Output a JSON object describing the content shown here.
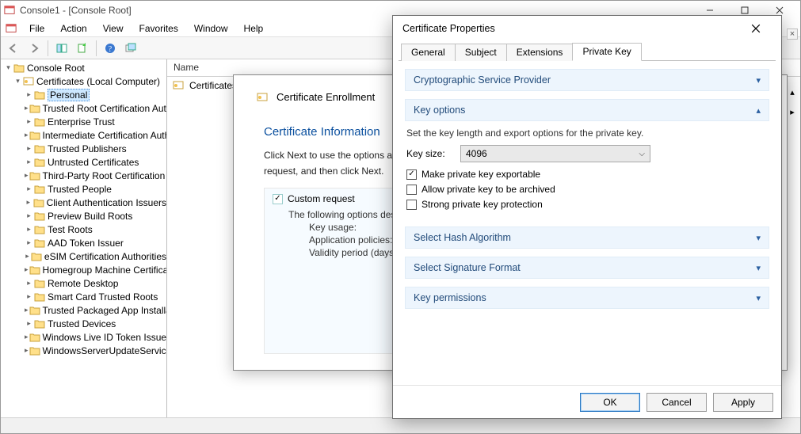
{
  "window": {
    "title": "Console1 - [Console Root]"
  },
  "menu": {
    "file": "File",
    "action": "Action",
    "view": "View",
    "favorites": "Favorites",
    "window": "Window",
    "help": "Help"
  },
  "tree": {
    "root": "Console Root",
    "certs": "Certificates (Local Computer)",
    "nodes": [
      "Personal",
      "Trusted Root Certification Authorities",
      "Enterprise Trust",
      "Intermediate Certification Authorities",
      "Trusted Publishers",
      "Untrusted Certificates",
      "Third-Party Root Certification Authorities",
      "Trusted People",
      "Client Authentication Issuers",
      "Preview Build Roots",
      "Test Roots",
      "AAD Token Issuer",
      "eSIM Certification Authorities",
      "Homegroup Machine Certificates",
      "Remote Desktop",
      "Smart Card Trusted Roots",
      "Trusted Packaged App Installation Authorities",
      "Trusted Devices",
      "Windows Live ID Token Issuer",
      "WindowsServerUpdateServices"
    ]
  },
  "list": {
    "column_name": "Name",
    "row_certs": "Certificates"
  },
  "wizard": {
    "title": "Certificate Enrollment",
    "heading": "Certificate Information",
    "info1": "Click Next to use the options already selected for this template, or click Details to customize the certificate",
    "info2": "request, and then click Next.",
    "custom_request": "Custom request",
    "custom_desc": "The following options describe the uses and validity period that apply to this type of certificate:",
    "kv_key_usage": "Key usage:",
    "kv_app_policies": "Application policies:",
    "kv_validity": "Validity period (days):"
  },
  "props": {
    "title": "Certificate Properties",
    "tabs": {
      "general": "General",
      "subject": "Subject",
      "extensions": "Extensions",
      "private_key": "Private Key"
    },
    "sections": {
      "csp": "Cryptographic Service Provider",
      "key_options": "Key options",
      "key_options_desc": "Set the key length and export options for the private key.",
      "key_size_label": "Key size:",
      "key_size_value": "4096",
      "chk_exportable": "Make private key exportable",
      "chk_archive": "Allow private key to be archived",
      "chk_strong": "Strong private key protection",
      "hash": "Select Hash Algorithm",
      "sig": "Select Signature Format",
      "perm": "Key permissions"
    },
    "buttons": {
      "ok": "OK",
      "cancel": "Cancel",
      "apply": "Apply"
    }
  }
}
